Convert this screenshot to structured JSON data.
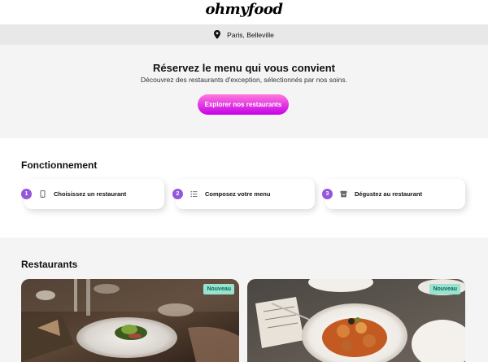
{
  "header": {
    "logo": "ohmyfood"
  },
  "location": {
    "text": "Paris, Belleville"
  },
  "hero": {
    "title": "Réservez le menu qui vous convient",
    "subtitle": "Découvrez des restaurants d'exception, sélectionnés par nos soins.",
    "cta_label": "Explorer nos restaurants"
  },
  "how": {
    "title": "Fonctionnement",
    "steps": [
      {
        "number": "1",
        "icon": "mobile-phone-icon",
        "label": "Choisissez un restaurant"
      },
      {
        "number": "2",
        "icon": "list-icon",
        "label": "Composez votre menu"
      },
      {
        "number": "3",
        "icon": "store-icon",
        "label": "Dégustez au restaurant"
      }
    ]
  },
  "restaurants": {
    "title": "Restaurants",
    "cards": [
      {
        "badge": "Nouveau"
      },
      {
        "badge": "Nouveau"
      }
    ]
  },
  "colors": {
    "accent_gradient_start": "#ff79da",
    "accent_gradient_end": "#c600e8",
    "step_number": "#9356dc",
    "badge_bg": "#99e2d0",
    "badge_text": "#0b6a55"
  }
}
